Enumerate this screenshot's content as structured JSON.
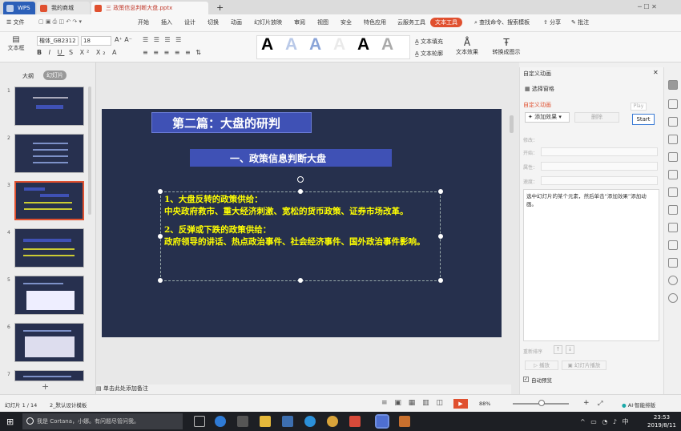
{
  "tabs": {
    "home": "WPS",
    "t1": "我的商城",
    "t2": "三 政策信息判断大盘.pptx",
    "plus": "+"
  },
  "menu": {
    "file": "文件",
    "items": [
      "开始",
      "插入",
      "设计",
      "切换",
      "动画",
      "幻灯片放映",
      "审阅",
      "视图",
      "安全",
      "特色应用",
      "云服务工具",
      "文本工具"
    ],
    "search": "查找命令、搜索模板",
    "share": "分享",
    "comment": "批注"
  },
  "ribbon": {
    "textbox": "文本框",
    "font_name": "楷体_GB2312",
    "font_size": "18",
    "text_fill": "文本填充",
    "text_outline": "文本轮廓",
    "text_effect": "文本效果",
    "to_art": "转换成图示"
  },
  "slides_panel": {
    "outline": "大纲",
    "slides": "幻灯片",
    "nums": [
      "1",
      "2",
      "3",
      "4",
      "5",
      "6",
      "7"
    ],
    "add": "+"
  },
  "slide": {
    "section": "第二篇：大盘的研判",
    "subtitle": "一、政策信息判断大盘",
    "p1_head": "1、大盘反转的政策供给：",
    "p1_body": "中央政府救市、重大经济刺激、宽松的货币政策、证券市场改革。",
    "p2_head": "2、反弹或下跌的政策供给：",
    "p2_body": "政府领导的讲话、热点政治事件、社会经济事件、国外政治事件影响。"
  },
  "anim_panel": {
    "title": "自定义动画",
    "select_pane": "选择窗格",
    "section": "自定义动画",
    "add_effect": "添加效果",
    "delete": "删除",
    "play": "Play",
    "start": "Start",
    "modify": "修改：",
    "start_label": "开始：",
    "property_label": "属性：",
    "speed_label": "速度：",
    "hint": "选中幻灯片的某个元素，然后单击“添加效果”添加动画。",
    "reorder": "重新排序",
    "play_btn": "播放",
    "slideshow_btn": "幻灯片播放",
    "autopreview": "自动预览"
  },
  "status": {
    "page": "幻灯片 1 / 14",
    "theme": "2_默认设计模板",
    "notes": "单击此处添加备注",
    "zoom": "88%",
    "ai": "AI·智能排版"
  },
  "taskbar": {
    "cortana": "我是 Cortana，小娜。有问题尽管问我。",
    "time": "23:53",
    "date": "2019/8/11"
  },
  "colors": {
    "accent": "#e0502f",
    "slide_bg": "#26304d",
    "title_box": "#3f51b5",
    "slide_text": "#ffff00"
  }
}
